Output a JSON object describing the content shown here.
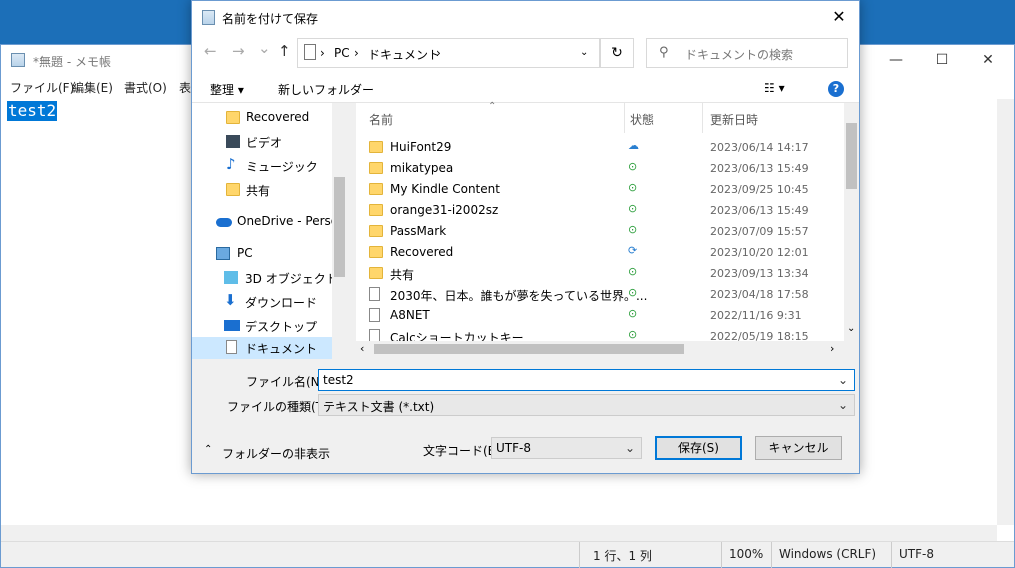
{
  "notepad": {
    "title": "*無題 - メモ帳",
    "controls": {
      "minimize": "—",
      "maximize": "☐",
      "close": "✕"
    },
    "menu": [
      "ファイル(F)",
      "編集(E)",
      "書式(O)",
      "表"
    ],
    "content": "test2",
    "status": {
      "position": "1 行、1 列",
      "zoom": "100%",
      "line_ending": "Windows (CRLF)",
      "encoding": "UTF-8"
    }
  },
  "dialog": {
    "title": "名前を付けて保存",
    "close": "✕",
    "nav": {
      "back": "←",
      "forward": "→",
      "recent": "⌄",
      "up": "↑"
    },
    "address": {
      "pc": "PC",
      "sep": "›",
      "folder": "ドキュメント"
    },
    "refresh": "↻",
    "search_placeholder": "ドキュメントの検索",
    "toolbar": {
      "organize": "整理 ▾",
      "new_folder": "新しいフォルダー",
      "view": "☷ ▾",
      "help": "?"
    },
    "sidebar": [
      {
        "label": "Recovered",
        "icon": "folder-icon"
      },
      {
        "label": "ビデオ",
        "icon": "video-icon"
      },
      {
        "label": "ミュージック",
        "icon": "music-icon"
      },
      {
        "label": "共有",
        "icon": "folder-icon"
      },
      {
        "label": "OneDrive - Persor",
        "icon": "cloud-icon"
      },
      {
        "label": "PC",
        "icon": "pc-icon"
      },
      {
        "label": "3D オブジェクト",
        "icon": "cube-icon"
      },
      {
        "label": "ダウンロード",
        "icon": "download-icon"
      },
      {
        "label": "デスクトップ",
        "icon": "desktop-icon"
      },
      {
        "label": "ドキュメント",
        "icon": "document-icon"
      }
    ],
    "columns": {
      "name": "名前",
      "status": "状態",
      "modified": "更新日時"
    },
    "files": [
      {
        "name": "HuiFont29",
        "status": "cloud",
        "modified": "2023/06/14 14:17",
        "type": "folder"
      },
      {
        "name": "mikatypea",
        "status": "synced",
        "modified": "2023/06/13 15:49",
        "type": "folder"
      },
      {
        "name": "My Kindle Content",
        "status": "synced",
        "modified": "2023/09/25 10:45",
        "type": "folder"
      },
      {
        "name": "orange31-i2002sz",
        "status": "synced",
        "modified": "2023/06/13 15:49",
        "type": "folder"
      },
      {
        "name": "PassMark",
        "status": "synced",
        "modified": "2023/07/09 15:57",
        "type": "folder"
      },
      {
        "name": "Recovered",
        "status": "syncing",
        "modified": "2023/10/20 12:01",
        "type": "folder"
      },
      {
        "name": "共有",
        "status": "synced",
        "modified": "2023/09/13 13:34",
        "type": "folder"
      },
      {
        "name": "2030年、日本。誰もが夢を失っている世界。...",
        "status": "synced",
        "modified": "2023/04/18 17:58",
        "type": "doc"
      },
      {
        "name": "A8NET",
        "status": "synced",
        "modified": "2022/11/16 9:31",
        "type": "doc"
      },
      {
        "name": "Calcショートカットキー",
        "status": "synced",
        "modified": "2022/05/19 18:15",
        "type": "doc"
      }
    ],
    "filename_label": "ファイル名(N):",
    "filename_value": "test2",
    "filetype_label": "ファイルの種類(T):",
    "filetype_value": "テキスト文書 (*.txt)",
    "hide_folders": "フォルダーの非表示",
    "encoding_label": "文字コード(E):",
    "encoding_value": "UTF-8",
    "save_button": "保存(S)",
    "cancel_button": "キャンセル",
    "colors": {
      "accent": "#0078d7",
      "synced": "#2a9d3a",
      "cloud": "#2a7fd0"
    }
  }
}
